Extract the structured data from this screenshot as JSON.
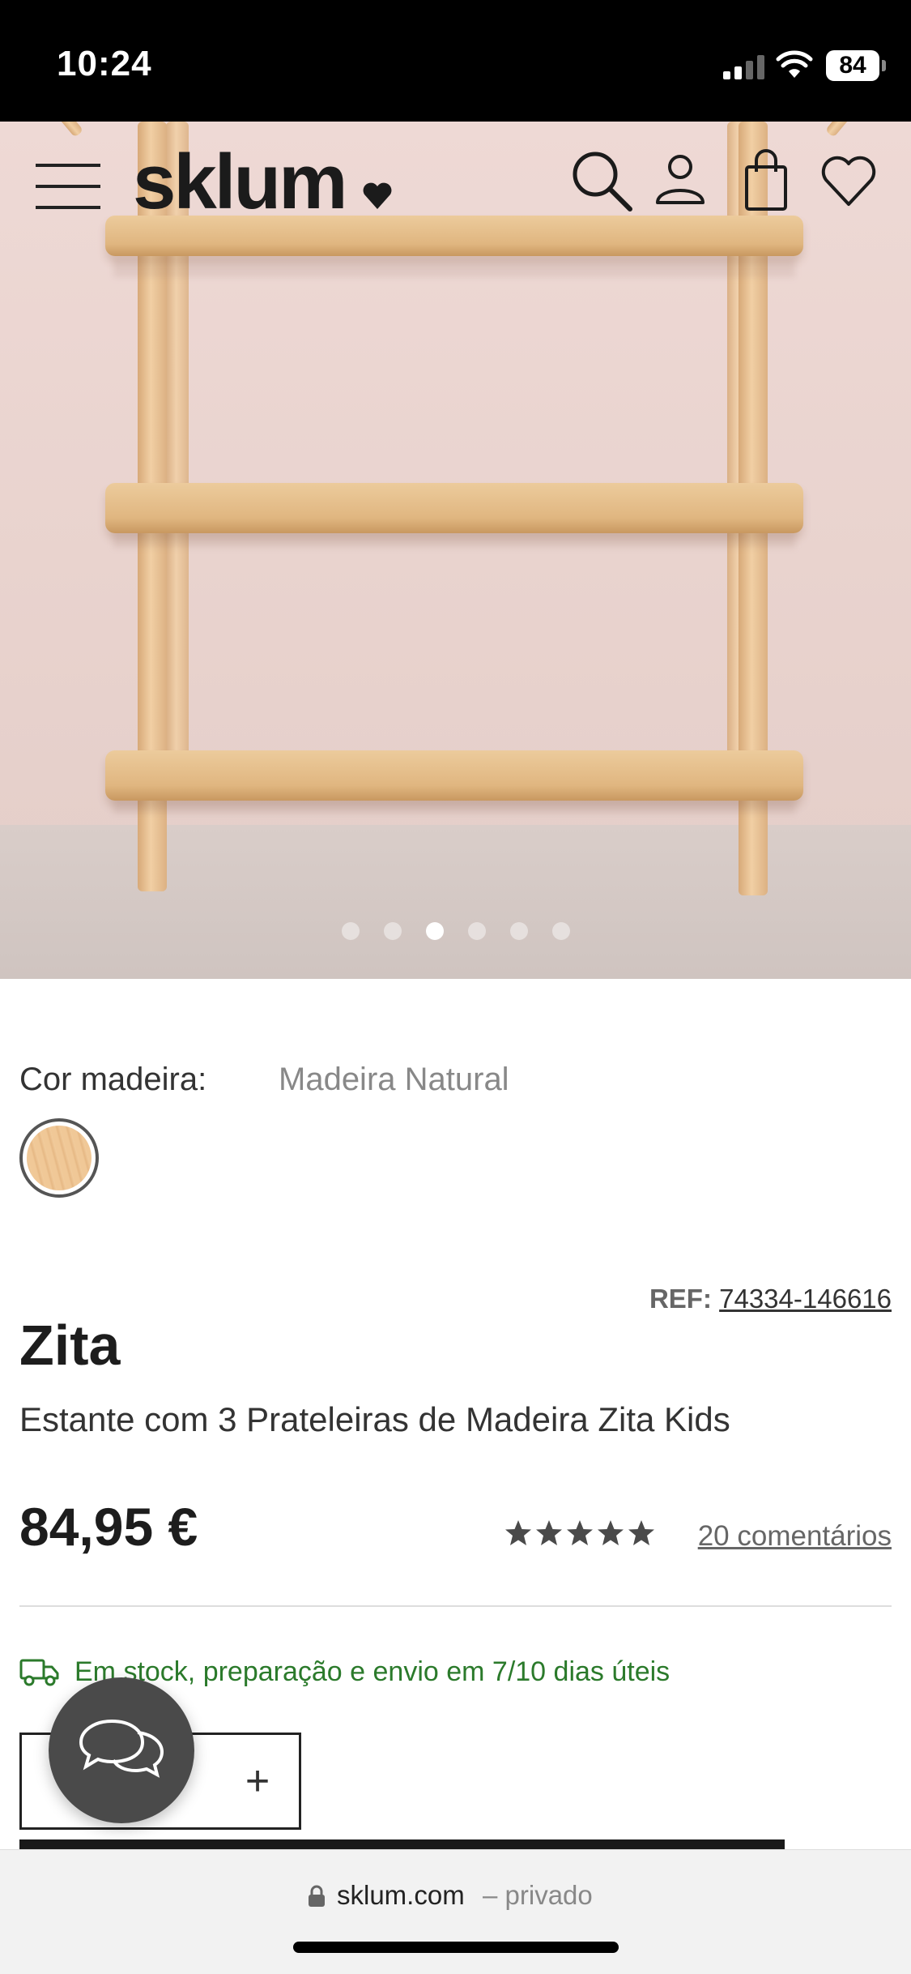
{
  "status_bar": {
    "time": "10:24",
    "battery": "84"
  },
  "header": {
    "logo": "sklum",
    "icons": [
      "menu-icon",
      "search-icon",
      "account-icon",
      "bag-icon",
      "heart-icon"
    ]
  },
  "gallery": {
    "image_count": 6,
    "active_index": 2
  },
  "product": {
    "color_label": "Cor madeira:",
    "color_value": "Madeira Natural",
    "ref_label": "REF:",
    "ref_value": "74334-146616",
    "name": "Zita",
    "description": "Estante com 3 Prateleiras de Madeira Zita Kids",
    "price": "84,95 €",
    "rating_stars": 5,
    "reviews": "20 comentários",
    "stock": "Em stock, preparação e envio em 7/10 dias úteis",
    "qty_plus": "+"
  },
  "browser": {
    "domain": "sklum.com",
    "mode": "– privado"
  },
  "colors": {
    "accent_green": "#2b7a2b",
    "text_dark": "#1d1d1d",
    "chat_bubble": "#4a4a4a"
  }
}
